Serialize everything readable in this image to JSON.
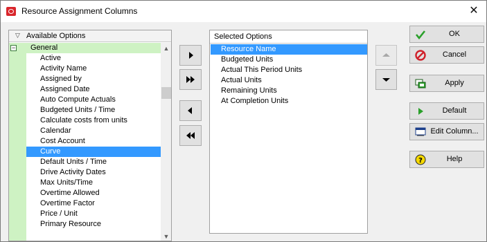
{
  "window": {
    "title": "Resource Assignment Columns",
    "close_glyph": "✕",
    "icon": "oracle-app-icon"
  },
  "available": {
    "header": "Available Options",
    "group_label": "General",
    "group_toggle": "−",
    "items": [
      "Active",
      "Activity Name",
      "Assigned by",
      "Assigned Date",
      "Auto Compute Actuals",
      "Budgeted Units / Time",
      "Calculate costs from units",
      "Calendar",
      "Cost Account",
      "Curve",
      "Default Units / Time",
      "Drive Activity Dates",
      "Max Units/Time",
      "Overtime Allowed",
      "Overtime Factor",
      "Price / Unit",
      "Primary Resource"
    ],
    "selected_item": "Curve",
    "scroll_up_glyph": "▲",
    "scroll_down_glyph": "▼"
  },
  "transfer_buttons": [
    {
      "name": "add-button",
      "icon": "arrow-right-icon"
    },
    {
      "name": "add-all-button",
      "icon": "double-arrow-right-icon"
    },
    {
      "name": "remove-button",
      "icon": "arrow-left-icon"
    },
    {
      "name": "remove-all-button",
      "icon": "double-arrow-left-icon"
    }
  ],
  "selected": {
    "header": "Selected Options",
    "items": [
      "Resource Name",
      "Budgeted Units",
      "Actual This Period Units",
      "Actual Units",
      "Remaining Units",
      "At Completion Units"
    ],
    "selected_item": "Resource Name"
  },
  "move_buttons": {
    "up_icon": "triangle-up-icon",
    "down_icon": "triangle-down-icon",
    "up_enabled": false
  },
  "commands": {
    "ok": "OK",
    "cancel": "Cancel",
    "apply": "Apply",
    "default": "Default",
    "edit_column": "Edit Column...",
    "help": "Help"
  },
  "colors": {
    "selection": "#3399ff",
    "tree_group_bg": "#cef2c3",
    "ok_check": "#2aa02a",
    "cancel_red": "#d0202a",
    "default_play": "#2aa02a",
    "help_yellow": "#f5d800"
  }
}
